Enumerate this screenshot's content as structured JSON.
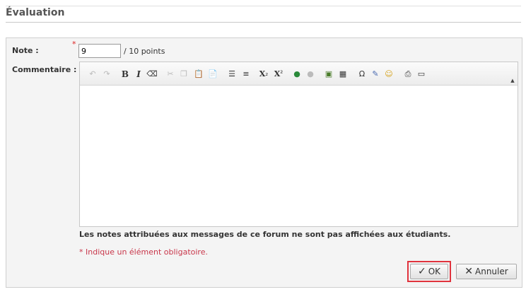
{
  "header": {
    "title": "Évaluation"
  },
  "form": {
    "note_label": "Note :",
    "note_required_marker": "*",
    "note_value": "9",
    "note_suffix": "/ 10 points",
    "comment_label": "Commentaire :",
    "info_text": "Les notes attribuées aux messages de ce forum ne sont pas affichées aux étudiants.",
    "required_text": "* Indique un élément obligatoire."
  },
  "editor": {
    "content": "",
    "toolbar": [
      "undo-icon",
      "redo-icon",
      "bold-icon",
      "italic-icon",
      "remove-format-icon",
      "cut-icon",
      "copy-icon",
      "paste-icon",
      "paste-word-icon",
      "bulleted-list-icon",
      "numbered-list-icon",
      "subscript-icon",
      "superscript-icon",
      "link-icon",
      "unlink-icon",
      "image-icon",
      "table-icon",
      "special-char-icon",
      "spellcheck-icon",
      "smiley-icon",
      "print-icon",
      "preview-icon"
    ]
  },
  "buttons": {
    "ok": "OK",
    "cancel": "Annuler"
  },
  "colors": {
    "required": "#c8364a",
    "highlight": "#e0333d"
  }
}
